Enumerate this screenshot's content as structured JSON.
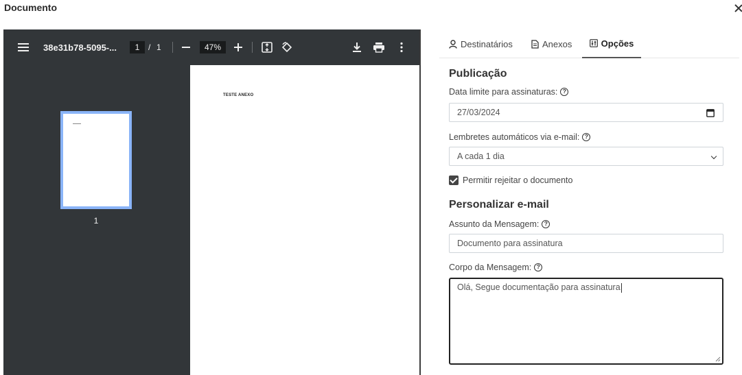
{
  "modal": {
    "title": "Documento"
  },
  "pdf_viewer": {
    "doc_name": "38e31b78-5095-...",
    "current_page": "1",
    "page_separator": "/",
    "total_pages": "1",
    "zoom": "47%",
    "thumbnail_page_number": "1",
    "page_text": "TESTE ANEXO"
  },
  "tabs": [
    {
      "label": "Destinatários",
      "icon": "person-icon"
    },
    {
      "label": "Anexos",
      "icon": "file-icon"
    },
    {
      "label": "Opções",
      "icon": "settings-sliders-icon",
      "active": true
    }
  ],
  "publication": {
    "section_title": "Publicação",
    "deadline_label": "Data limite para assinaturas:",
    "deadline_value": "27/03/2024",
    "reminders_label": "Lembretes automáticos via e-mail:",
    "reminders_value": "A cada 1 dia",
    "allow_reject_label": "Permitir rejeitar o documento",
    "allow_reject_checked": true
  },
  "email": {
    "section_title": "Personalizar e-mail",
    "subject_label": "Assunto da Mensagem:",
    "subject_value": "Documento para assinatura",
    "body_label": "Corpo da Mensagem:",
    "body_value": "Olá, Segue documentação para assinatura"
  },
  "help_glyph": "?"
}
